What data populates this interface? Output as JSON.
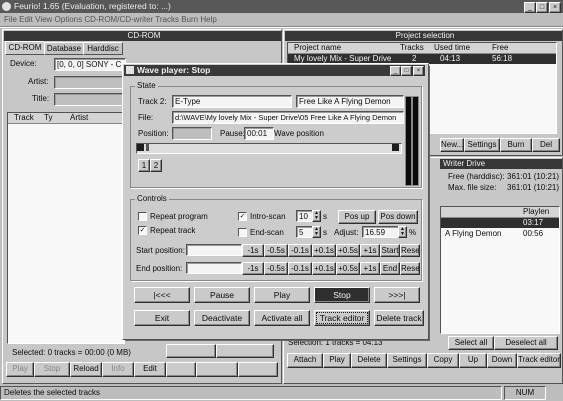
{
  "app": {
    "title": "Feurio! 1.65 (Evaluation, registered to: ...)",
    "menu": "File  Edit  View  Options  CD-ROM/CD-writer  Tracks  Burn  Help"
  },
  "cd_panel": {
    "title": "CD-ROM",
    "tabs": [
      "CD-ROM",
      "Database",
      "Harddisc"
    ],
    "device_label": "Device:",
    "device_value": "[0, 0, 0]  SONY - C",
    "artist_label": "Artist:",
    "title_label": "Title:",
    "columns": [
      "Track",
      "Ty",
      "Artist"
    ],
    "selected_text": "Selected: 0 tracks = 00:00 (0 MB)",
    "buttons": [
      "Play",
      "Stop",
      "Reload",
      "Info",
      "Edit",
      "",
      "",
      ""
    ]
  },
  "project_panel": {
    "title": "Project selection",
    "columns": [
      "Project name",
      "Tracks",
      "Used time",
      "Free"
    ],
    "rows": [
      {
        "name": "My lovely Mix - Super Drive",
        "tracks": "2",
        "used": "04:13",
        "free": "56:18"
      }
    ],
    "buttons": [
      "New...",
      "Settings",
      "Burn",
      "Del"
    ]
  },
  "drive_panel": {
    "title": "Writer Drive",
    "free_hd_label": "Free (harddisc):",
    "free_hd_value": "361:01 (10:21)",
    "max_size_label": "Max. file size:",
    "max_size_value": "361:01 (10:21)",
    "columns": [
      "",
      "Playlen"
    ],
    "rows": [
      {
        "name": "",
        "len": "03:17",
        "sel": true
      },
      {
        "name": "A Flying Demon",
        "len": "00:56",
        "sel": false
      }
    ],
    "selection_text": "Selection: 1 tracks = 04:13",
    "select_all": "Select all",
    "deselect_all": "Deselect all",
    "bottom_buttons": [
      "Attach",
      "Play",
      "Delete",
      "Settings",
      "Copy",
      "Up",
      "Down",
      "Track editor"
    ]
  },
  "statusbar": {
    "message": "Deletes the selected tracks",
    "num": "NUM"
  },
  "dialog": {
    "title": "Wave player: Stop",
    "state_group": "State",
    "track_label": "Track 2:",
    "track_artist": "E-Type",
    "track_title": "Free Like A Flying Demon",
    "file_label": "File:",
    "file_path": "d:\\WAVE\\My lovely Mix - Super Drive\\05 Free Like A Flying Demon",
    "position_label": "Position:",
    "position_value": "",
    "pause_label": "Pause:",
    "pause_value": "00:01",
    "wave_position_label": "Wave position",
    "sub_buttons": [
      "1",
      "2"
    ],
    "controls_group": "Controls",
    "repeat_program": "Repeat program",
    "repeat_track": "Repeat track",
    "intro_scan": "Intro-scan",
    "intro_value": "10",
    "intro_unit": "s",
    "pos_up": "Pos up",
    "pos_down": "Pos down",
    "end_scan": "End-scan",
    "end_value": "5",
    "end_unit": "s",
    "adjust_label": "Adjust:",
    "adjust_value": "16.59",
    "adjust_unit": "%",
    "start_position_label": "Start position:",
    "end_position_label": "End position:",
    "start_buttons": [
      "-1s",
      "-0.5s",
      "-0.1s",
      "+0.1s",
      "+0.5s",
      "+1s",
      "Start",
      "Reset"
    ],
    "end_buttons": [
      "-1s",
      "-0.5s",
      "-0.1s",
      "+0.1s",
      "+0.5s",
      "+1s",
      "End",
      "Reset"
    ],
    "transport": [
      "|<<<",
      "Pause",
      "Play",
      "Stop",
      ">>>|"
    ],
    "actions": [
      "Exit",
      "Deactivate",
      "Activate all",
      "Track editor",
      "Delete track"
    ],
    "checks": {
      "repeat_program": false,
      "repeat_track": true,
      "intro_scan": true,
      "end_scan": false
    }
  }
}
